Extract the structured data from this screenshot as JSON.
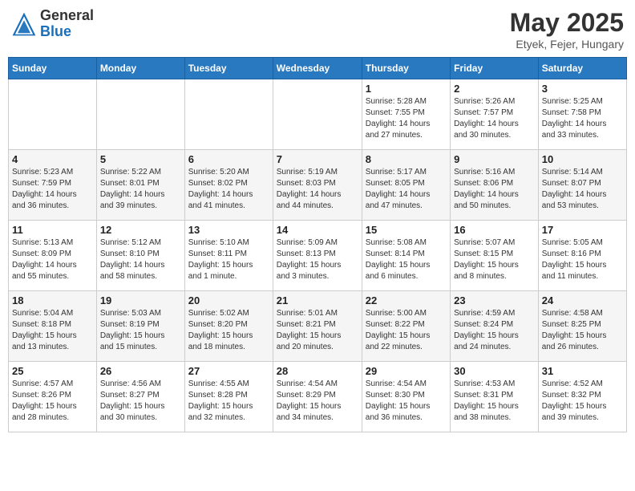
{
  "header": {
    "logo_general": "General",
    "logo_blue": "Blue",
    "month_year": "May 2025",
    "location": "Etyek, Fejer, Hungary"
  },
  "days_of_week": [
    "Sunday",
    "Monday",
    "Tuesday",
    "Wednesday",
    "Thursday",
    "Friday",
    "Saturday"
  ],
  "weeks": [
    [
      {
        "day": "",
        "details": ""
      },
      {
        "day": "",
        "details": ""
      },
      {
        "day": "",
        "details": ""
      },
      {
        "day": "",
        "details": ""
      },
      {
        "day": "1",
        "details": "Sunrise: 5:28 AM\nSunset: 7:55 PM\nDaylight: 14 hours\nand 27 minutes."
      },
      {
        "day": "2",
        "details": "Sunrise: 5:26 AM\nSunset: 7:57 PM\nDaylight: 14 hours\nand 30 minutes."
      },
      {
        "day": "3",
        "details": "Sunrise: 5:25 AM\nSunset: 7:58 PM\nDaylight: 14 hours\nand 33 minutes."
      }
    ],
    [
      {
        "day": "4",
        "details": "Sunrise: 5:23 AM\nSunset: 7:59 PM\nDaylight: 14 hours\nand 36 minutes."
      },
      {
        "day": "5",
        "details": "Sunrise: 5:22 AM\nSunset: 8:01 PM\nDaylight: 14 hours\nand 39 minutes."
      },
      {
        "day": "6",
        "details": "Sunrise: 5:20 AM\nSunset: 8:02 PM\nDaylight: 14 hours\nand 41 minutes."
      },
      {
        "day": "7",
        "details": "Sunrise: 5:19 AM\nSunset: 8:03 PM\nDaylight: 14 hours\nand 44 minutes."
      },
      {
        "day": "8",
        "details": "Sunrise: 5:17 AM\nSunset: 8:05 PM\nDaylight: 14 hours\nand 47 minutes."
      },
      {
        "day": "9",
        "details": "Sunrise: 5:16 AM\nSunset: 8:06 PM\nDaylight: 14 hours\nand 50 minutes."
      },
      {
        "day": "10",
        "details": "Sunrise: 5:14 AM\nSunset: 8:07 PM\nDaylight: 14 hours\nand 53 minutes."
      }
    ],
    [
      {
        "day": "11",
        "details": "Sunrise: 5:13 AM\nSunset: 8:09 PM\nDaylight: 14 hours\nand 55 minutes."
      },
      {
        "day": "12",
        "details": "Sunrise: 5:12 AM\nSunset: 8:10 PM\nDaylight: 14 hours\nand 58 minutes."
      },
      {
        "day": "13",
        "details": "Sunrise: 5:10 AM\nSunset: 8:11 PM\nDaylight: 15 hours\nand 1 minute."
      },
      {
        "day": "14",
        "details": "Sunrise: 5:09 AM\nSunset: 8:13 PM\nDaylight: 15 hours\nand 3 minutes."
      },
      {
        "day": "15",
        "details": "Sunrise: 5:08 AM\nSunset: 8:14 PM\nDaylight: 15 hours\nand 6 minutes."
      },
      {
        "day": "16",
        "details": "Sunrise: 5:07 AM\nSunset: 8:15 PM\nDaylight: 15 hours\nand 8 minutes."
      },
      {
        "day": "17",
        "details": "Sunrise: 5:05 AM\nSunset: 8:16 PM\nDaylight: 15 hours\nand 11 minutes."
      }
    ],
    [
      {
        "day": "18",
        "details": "Sunrise: 5:04 AM\nSunset: 8:18 PM\nDaylight: 15 hours\nand 13 minutes."
      },
      {
        "day": "19",
        "details": "Sunrise: 5:03 AM\nSunset: 8:19 PM\nDaylight: 15 hours\nand 15 minutes."
      },
      {
        "day": "20",
        "details": "Sunrise: 5:02 AM\nSunset: 8:20 PM\nDaylight: 15 hours\nand 18 minutes."
      },
      {
        "day": "21",
        "details": "Sunrise: 5:01 AM\nSunset: 8:21 PM\nDaylight: 15 hours\nand 20 minutes."
      },
      {
        "day": "22",
        "details": "Sunrise: 5:00 AM\nSunset: 8:22 PM\nDaylight: 15 hours\nand 22 minutes."
      },
      {
        "day": "23",
        "details": "Sunrise: 4:59 AM\nSunset: 8:24 PM\nDaylight: 15 hours\nand 24 minutes."
      },
      {
        "day": "24",
        "details": "Sunrise: 4:58 AM\nSunset: 8:25 PM\nDaylight: 15 hours\nand 26 minutes."
      }
    ],
    [
      {
        "day": "25",
        "details": "Sunrise: 4:57 AM\nSunset: 8:26 PM\nDaylight: 15 hours\nand 28 minutes."
      },
      {
        "day": "26",
        "details": "Sunrise: 4:56 AM\nSunset: 8:27 PM\nDaylight: 15 hours\nand 30 minutes."
      },
      {
        "day": "27",
        "details": "Sunrise: 4:55 AM\nSunset: 8:28 PM\nDaylight: 15 hours\nand 32 minutes."
      },
      {
        "day": "28",
        "details": "Sunrise: 4:54 AM\nSunset: 8:29 PM\nDaylight: 15 hours\nand 34 minutes."
      },
      {
        "day": "29",
        "details": "Sunrise: 4:54 AM\nSunset: 8:30 PM\nDaylight: 15 hours\nand 36 minutes."
      },
      {
        "day": "30",
        "details": "Sunrise: 4:53 AM\nSunset: 8:31 PM\nDaylight: 15 hours\nand 38 minutes."
      },
      {
        "day": "31",
        "details": "Sunrise: 4:52 AM\nSunset: 8:32 PM\nDaylight: 15 hours\nand 39 minutes."
      }
    ]
  ]
}
